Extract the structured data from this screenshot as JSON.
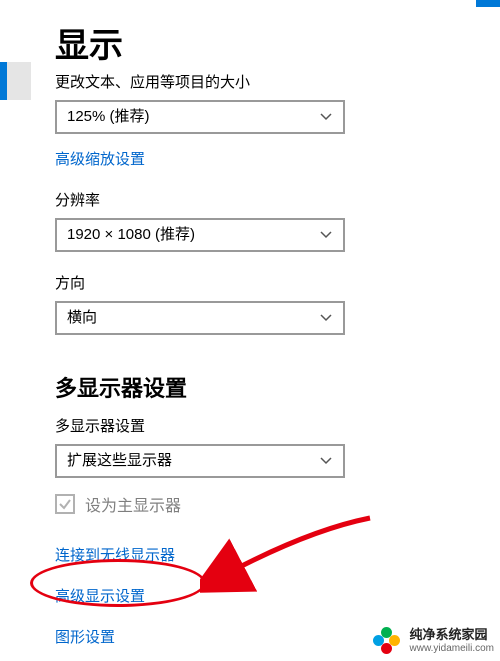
{
  "page": {
    "title": "显示",
    "scale_section_label_cut": "更改文本、应用等项目的大小",
    "scale_select_value": "125% (推荐)",
    "advanced_scale_link": "高级缩放设置",
    "resolution_label": "分辨率",
    "resolution_value": "1920 × 1080 (推荐)",
    "orientation_label": "方向",
    "orientation_value": "横向",
    "multi_monitor_heading": "多显示器设置",
    "multi_monitor_label": "多显示器设置",
    "multi_monitor_value": "扩展这些显示器",
    "primary_monitor_checkbox": "设为主显示器",
    "link_wireless": "连接到无线显示器",
    "link_advanced_display": "高级显示设置",
    "link_graphics": "图形设置",
    "watermark_title": "纯净系统家园",
    "watermark_sub": "www.yidameili.com"
  }
}
